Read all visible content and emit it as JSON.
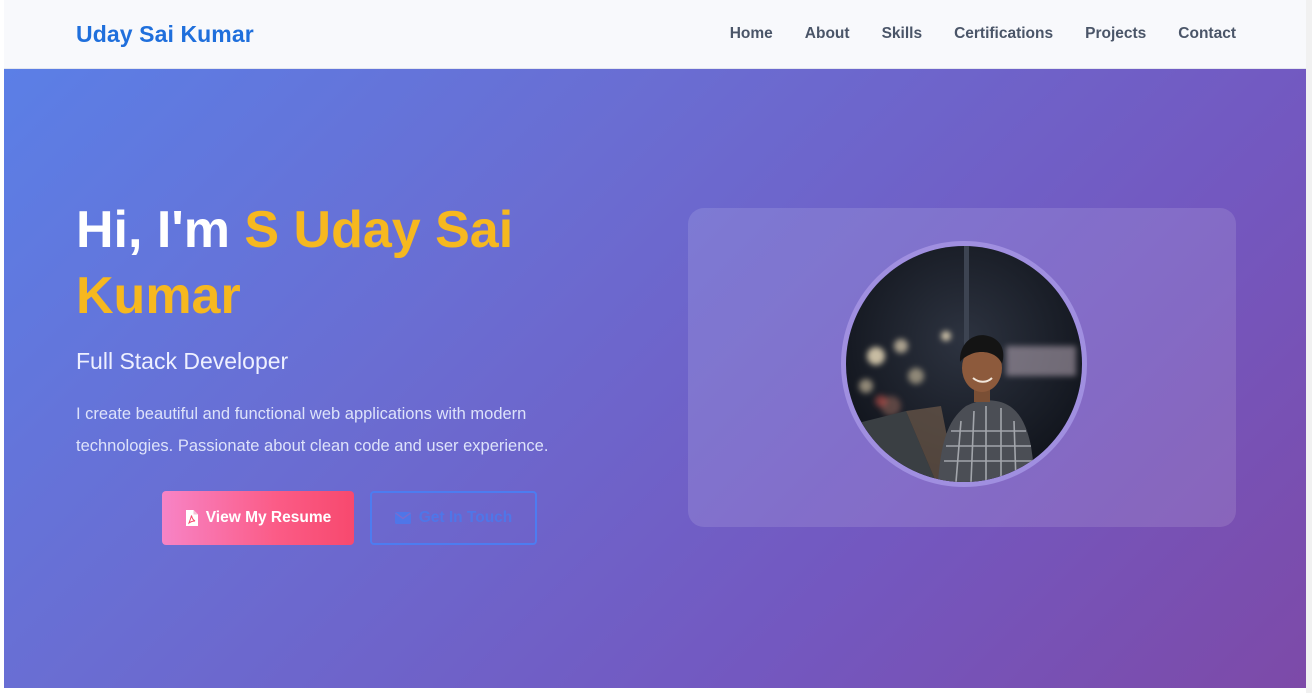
{
  "navbar": {
    "brand": "Uday Sai Kumar",
    "links": [
      "Home",
      "About",
      "Skills",
      "Certifications",
      "Projects",
      "Contact"
    ]
  },
  "hero": {
    "greeting": "Hi, I'm ",
    "name": "S Uday Sai Kumar",
    "role": "Full Stack Developer",
    "description": "I create beautiful and functional web applications with modern technologies. Passionate about clean code and user experience.",
    "resume_button": "View My Resume",
    "contact_button": "Get In Touch",
    "resume_icon": "pdf-file-icon",
    "contact_icon": "envelope-icon"
  },
  "colors": {
    "brand": "#1f6fdc",
    "name_highlight": "#f6b81f",
    "gradient_start": "#5b7fe6",
    "gradient_end": "#7d4aa8"
  }
}
